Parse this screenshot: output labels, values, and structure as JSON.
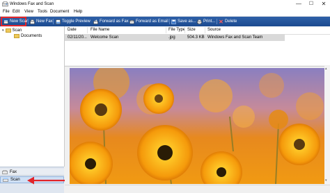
{
  "window": {
    "title": "Windows Fax and Scan",
    "icon": "fax-scan-app-icon"
  },
  "window_controls": {
    "minimize": "—",
    "maximize": "☐",
    "close": "✕"
  },
  "menu": [
    "File",
    "Edit",
    "View",
    "Tools",
    "Document",
    "Help"
  ],
  "toolbar": {
    "new_scan": "New Scan",
    "new_fax": "New Fax",
    "toggle_preview": "Toggle Preview",
    "forward_as_fax": "Forward as Fax",
    "forward_as_email": "Forward as Email",
    "save_as": "Save as...",
    "print": "Print...",
    "delete": "Delete"
  },
  "tree": {
    "root": "Scan",
    "child": "Documents"
  },
  "nav": {
    "fax": "Fax",
    "scan": "Scan"
  },
  "list": {
    "columns": [
      "Date",
      "File Name",
      "File Type",
      "Size",
      "Source"
    ],
    "rows": [
      {
        "date": "02/11/20...",
        "file_name": "Welcome Scan",
        "file_type": ".jpg",
        "size": "504.3 KB",
        "source": "Windows Fax and Scan Team"
      }
    ]
  },
  "colors": {
    "toolbar": "#2356a0",
    "highlight": "#e2252b",
    "selected_row": "#d9d9d9"
  }
}
